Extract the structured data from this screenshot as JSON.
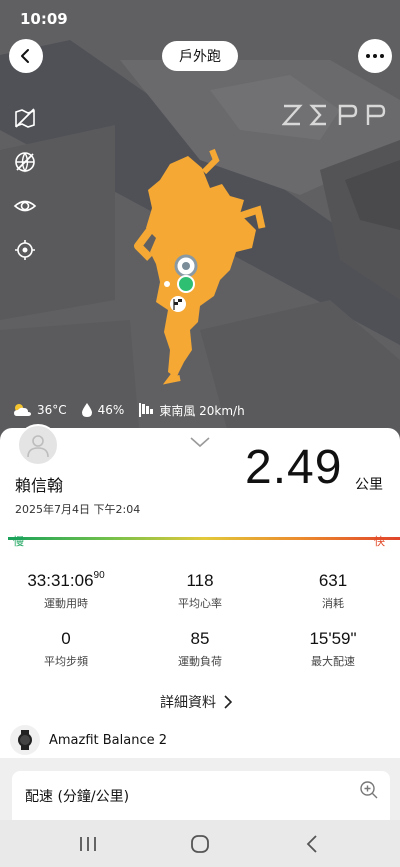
{
  "status_bar": {
    "time": "10:09"
  },
  "header": {
    "title": "戶外跑"
  },
  "map": {
    "logo_text": "ZEPP",
    "route_color": "#f5a834"
  },
  "weather": {
    "temperature": "36°C",
    "humidity": "46%",
    "wind": "東南風 20km/h"
  },
  "user": {
    "name": "賴信翰",
    "date": "2025年7月4日 下午2:04"
  },
  "summary": {
    "distance": "2.49",
    "unit": "公里"
  },
  "pace_scale": {
    "slow": "慢",
    "fast": "快"
  },
  "stats": {
    "duration": {
      "main": "33:31:06",
      "fraction": "90",
      "label": "運動用時"
    },
    "avg_hr": {
      "value": "118",
      "label": "平均心率"
    },
    "calories": {
      "value": "631",
      "label": "消耗"
    },
    "cadence": {
      "value": "0",
      "label": "平均步頻"
    },
    "load": {
      "value": "85",
      "label": "運動負荷"
    },
    "max_pace": {
      "value": "15'59\"",
      "label": "最大配速"
    }
  },
  "details_link": "詳細資料",
  "device": {
    "name": "Amazfit Balance 2"
  },
  "pace_section": {
    "title": "配速 (分鐘/公里)"
  }
}
